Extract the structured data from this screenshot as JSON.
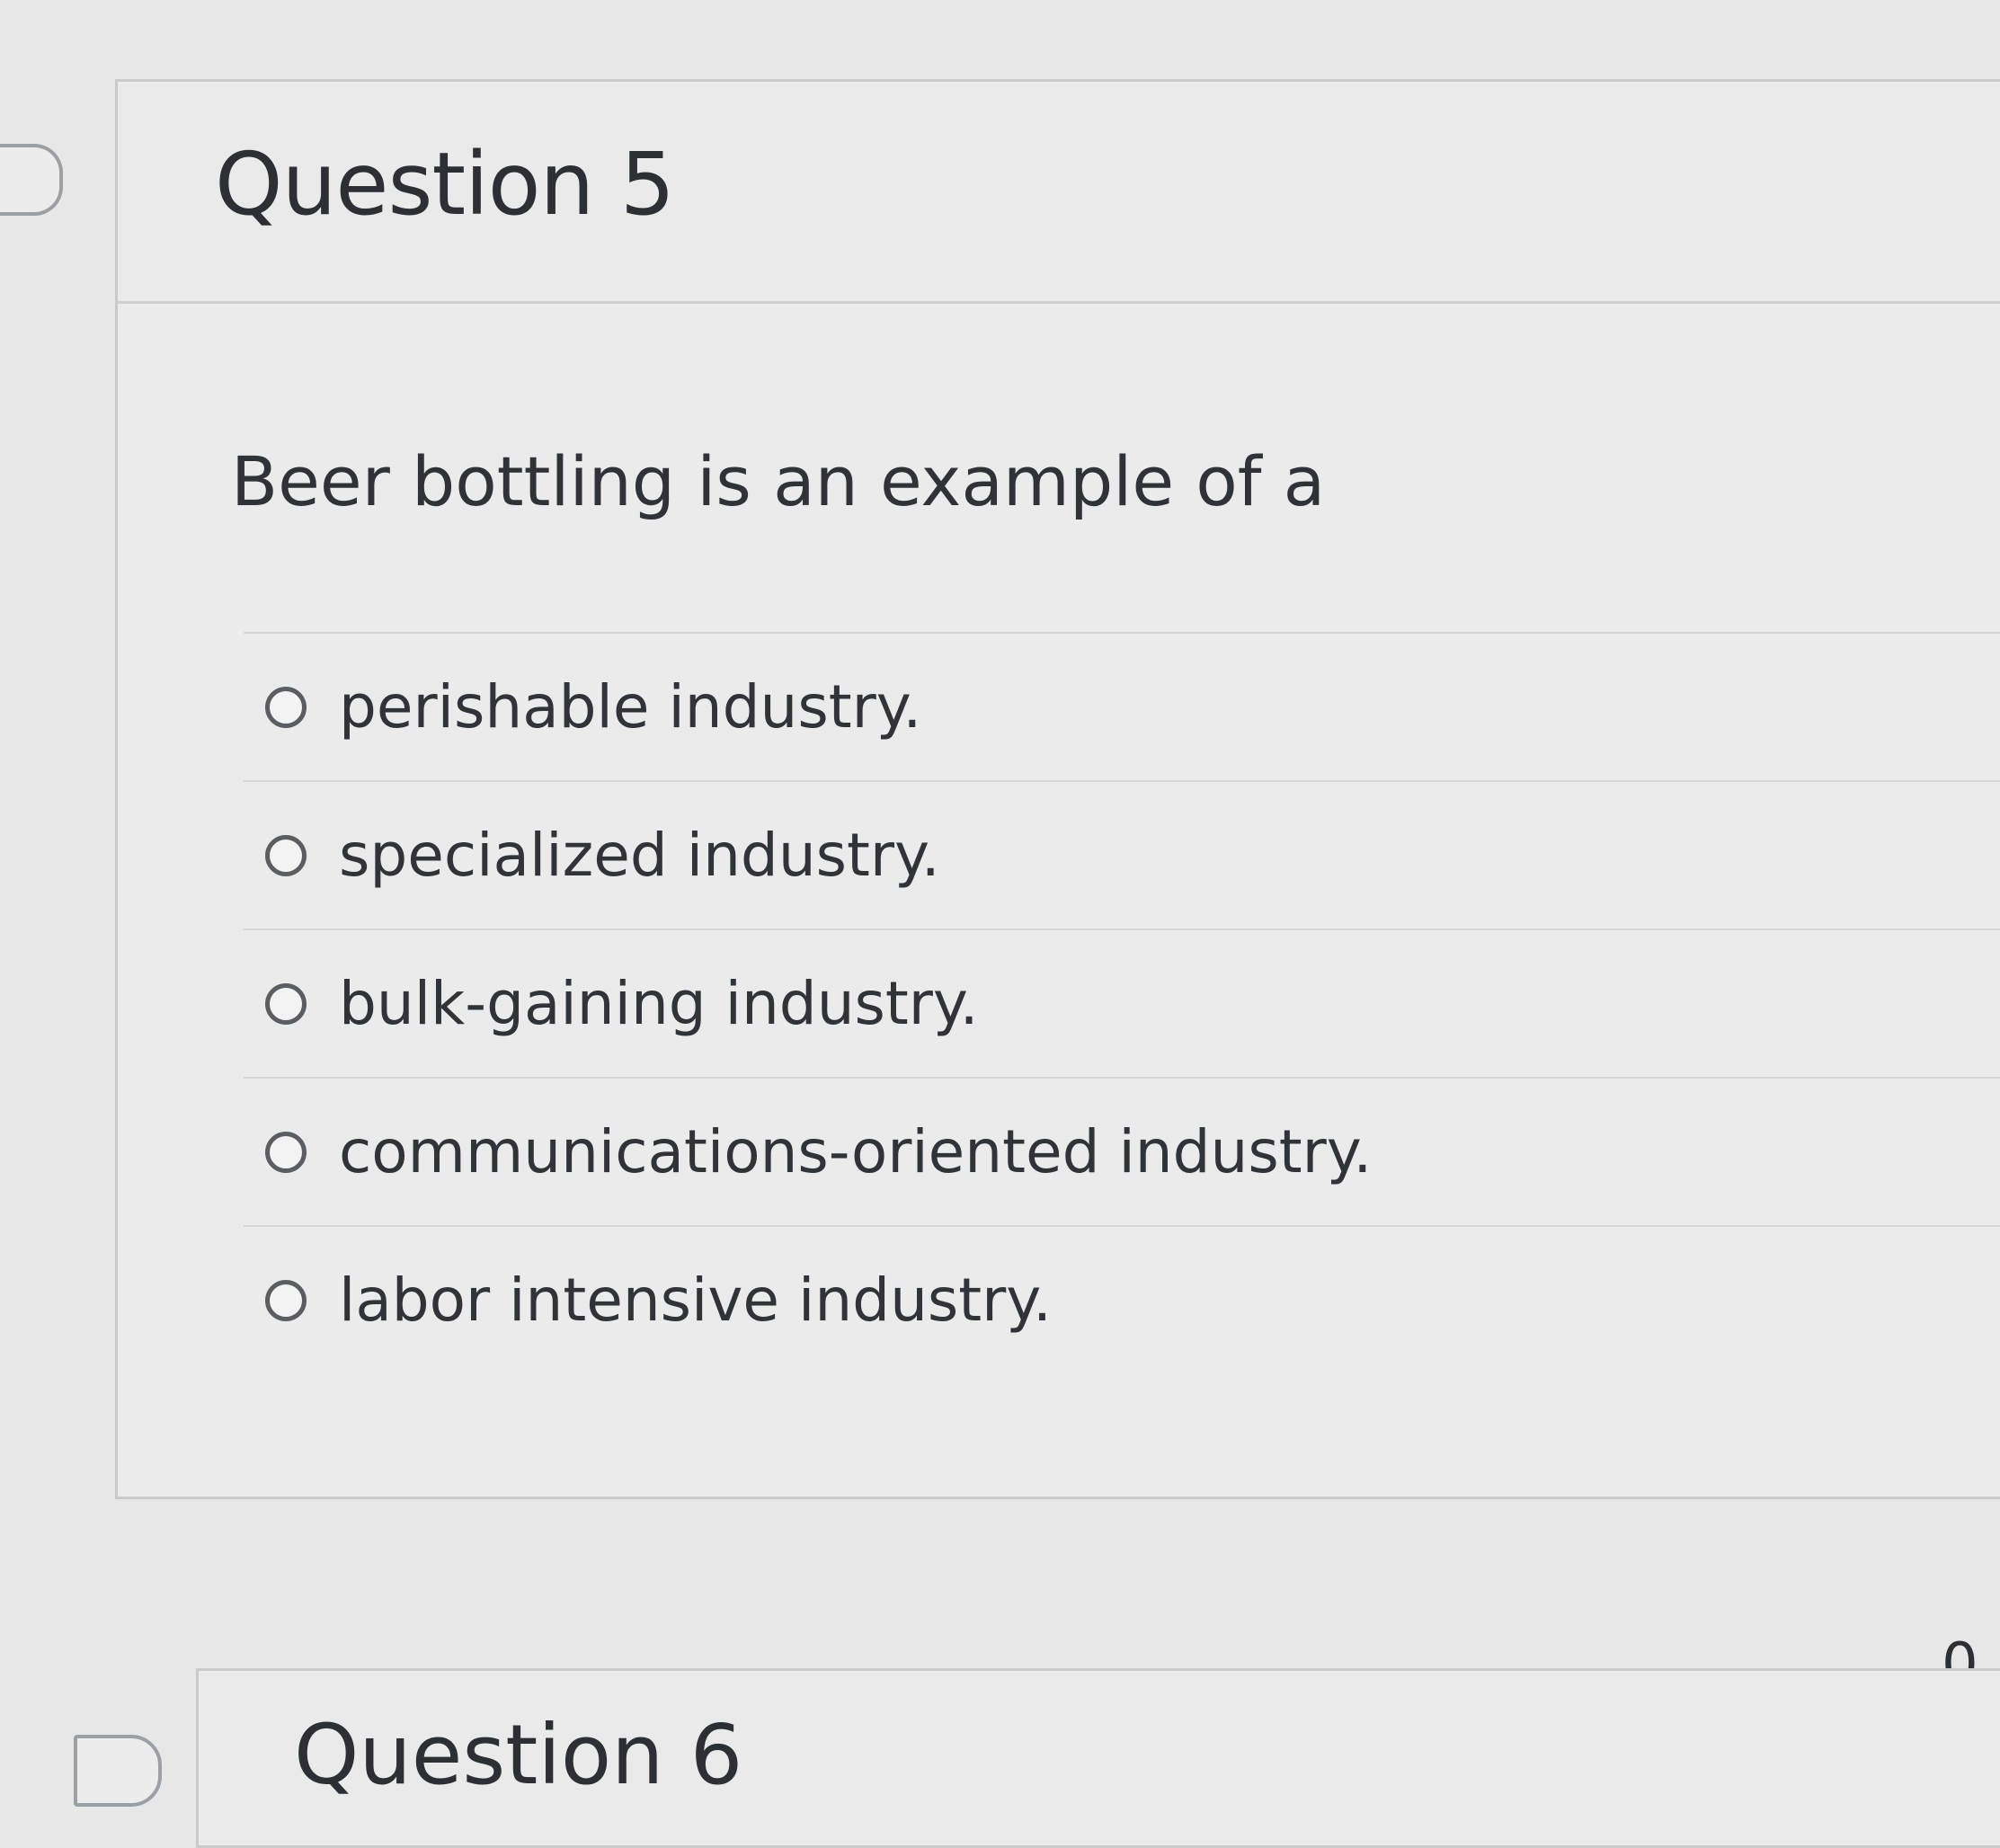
{
  "question": {
    "title": "Question 5",
    "prompt": "Beer bottling is an example of a",
    "answers": [
      {
        "label": "perishable industry.",
        "selected": false
      },
      {
        "label": "specialized industry.",
        "selected": false
      },
      {
        "label": "bulk-gaining industry.",
        "selected": false
      },
      {
        "label": "communications-oriented industry.",
        "selected": false
      },
      {
        "label": "labor intensive industry.",
        "selected": false
      }
    ]
  },
  "next_question": {
    "title": "Question 6",
    "points": "0."
  }
}
